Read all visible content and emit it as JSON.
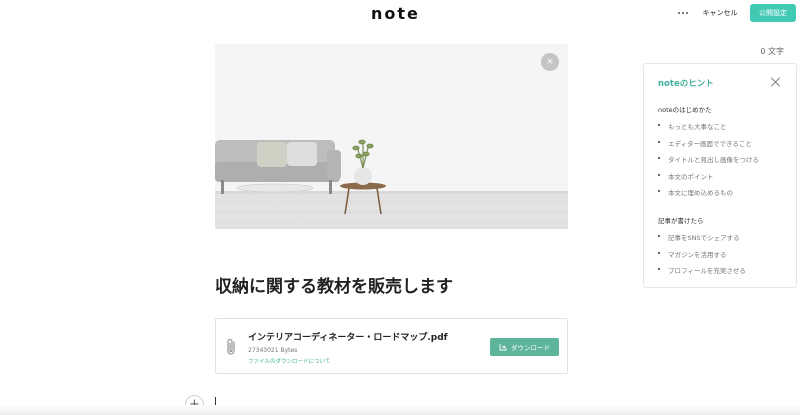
{
  "header": {
    "logo": "note",
    "more_icon": "more-horizontal-icon",
    "cancel_label": "キャンセル",
    "publish_label": "公開設定",
    "accent_color": "#41c9b4"
  },
  "editor": {
    "char_count": "0 文字",
    "cover_remove": "×",
    "title": "収納に関する教材を販売します",
    "attachment": {
      "file_name": "インテリアコーディネーター・ロードマップ.pdf",
      "file_size": "27343021 Bytes",
      "note": "ファイルのダウンロードについて",
      "download_label": "ダウンロード"
    },
    "add_block": "+"
  },
  "hints": {
    "title": "noteのヒント",
    "sections": [
      {
        "heading": "noteのはじめかた",
        "items": [
          "もっとも大事なこと",
          "エディター画面でできること",
          "タイトルと見出し画像をつける",
          "本文のポイント",
          "本文に埋め込めるもの"
        ]
      },
      {
        "heading": "記事が書けたら",
        "items": [
          "記事をSNSでシェアする",
          "マガジンを活用する",
          "プロフィールを充実させる"
        ]
      }
    ]
  }
}
